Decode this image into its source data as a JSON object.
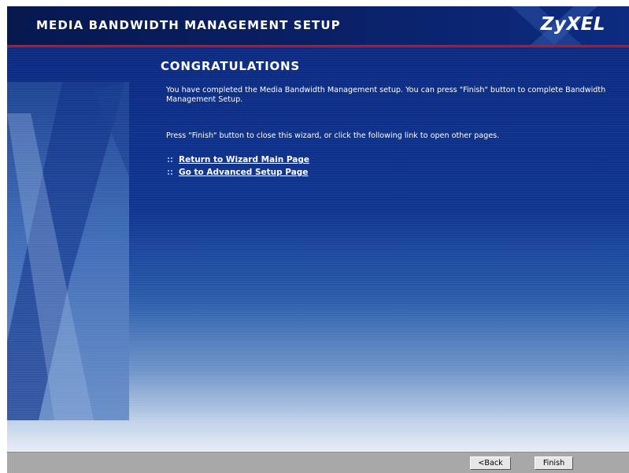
{
  "header": {
    "title": "MEDIA BANDWIDTH MANAGEMENT SETUP",
    "logo": "ZyXEL"
  },
  "main": {
    "heading": "CONGRATULATIONS",
    "message_complete": "You have completed the Media Bandwidth Management setup. You can press \"Finish\" button to complete Bandwidth Management Setup.",
    "message_instructions": "Press \"Finish\" button to close this wizard, or click the following link to open other pages.",
    "links": [
      {
        "label": "Return to Wizard Main Page"
      },
      {
        "label": "Go to Advanced Setup Page"
      }
    ]
  },
  "footer": {
    "back_label": "<Back",
    "finish_label": "Finish"
  },
  "colors": {
    "header_bg": "#0a2168",
    "accent_red": "#c0141c",
    "content_bg": "#0e3590",
    "footer_bg": "#a8a8a8"
  }
}
